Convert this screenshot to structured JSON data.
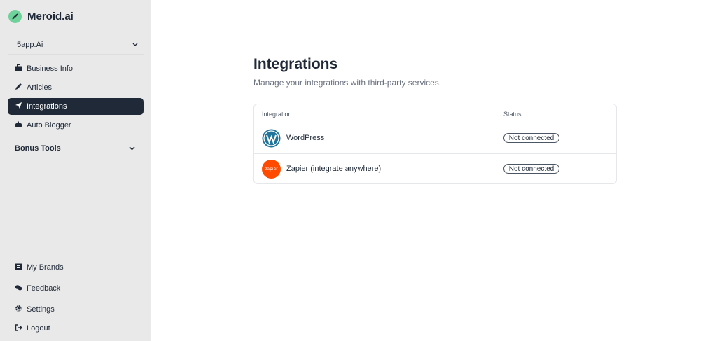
{
  "brand": {
    "name": "Meroid.ai"
  },
  "workspace": {
    "name": "5app.Ai"
  },
  "nav": {
    "business_info": "Business Info",
    "articles": "Articles",
    "integrations": "Integrations",
    "auto_blogger": "Auto Blogger",
    "bonus_tools": "Bonus Tools",
    "my_brands": "My Brands",
    "feedback": "Feedback",
    "settings": "Settings",
    "logout": "Logout"
  },
  "main": {
    "title": "Integrations",
    "subtitle": "Manage your integrations with third-party services.",
    "table": {
      "columns": [
        "Integration",
        "Status"
      ],
      "rows": [
        {
          "name": "WordPress",
          "status": "Not connected",
          "icon": "wordpress-icon"
        },
        {
          "name": "Zapier (integrate anywhere)",
          "status": "Not connected",
          "icon": "zapier-icon",
          "logo_text": "zapier"
        }
      ]
    }
  },
  "colors": {
    "sidebar_bg": "#e9e9e9",
    "active_bg": "#1f2937",
    "brand_green": "#6ed29a",
    "zapier_orange": "#ff4a00",
    "wordpress_blue": "#21759b"
  }
}
